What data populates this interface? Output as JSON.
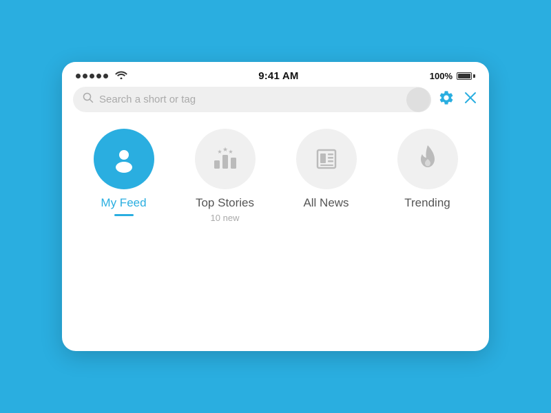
{
  "statusBar": {
    "time": "9:41 AM",
    "battery": "100%",
    "batteryFull": true
  },
  "search": {
    "placeholder": "Search a short or tag"
  },
  "toolbar": {
    "gear_label": "⚙",
    "close_label": "✕"
  },
  "nav": {
    "items": [
      {
        "id": "my-feed",
        "label": "My Feed",
        "active": true,
        "sublabel": ""
      },
      {
        "id": "top-stories",
        "label": "Top Stories",
        "active": false,
        "sublabel": "10 new"
      },
      {
        "id": "all-news",
        "label": "All News",
        "active": false,
        "sublabel": ""
      },
      {
        "id": "trending",
        "label": "Trending",
        "active": false,
        "sublabel": ""
      }
    ]
  }
}
